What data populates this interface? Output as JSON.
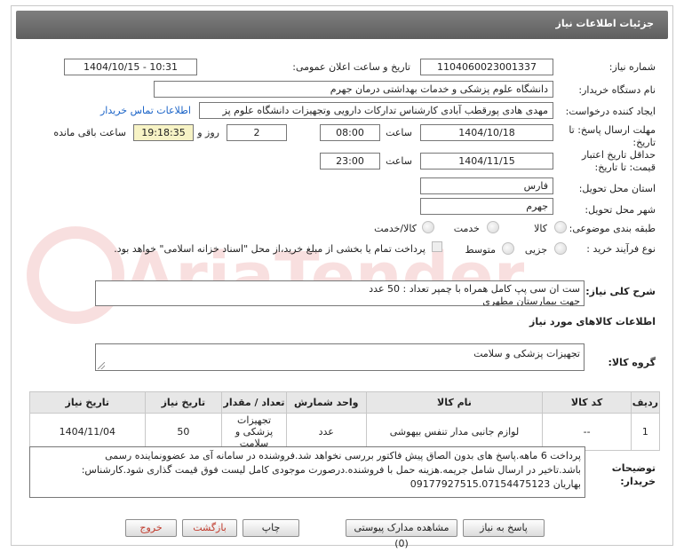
{
  "header": {
    "title": "جزئیات اطلاعات نیاز"
  },
  "watermark": {
    "text": "AriaTender.net"
  },
  "form": {
    "need_number_label": "شماره نیاز:",
    "need_number": "1104060023001337",
    "announce_label": "تاریخ و ساعت اعلان عمومی:",
    "announce_value": "1404/10/15 - 10:31",
    "buyer_org_label": "نام دستگاه خریدار:",
    "buyer_org": "دانشگاه علوم پزشکی و خدمات بهداشتی  درمان جهرم",
    "requester_label": "ایجاد کننده درخواست:",
    "requester": "مهدی هادی پورقطب آبادی کارشناس تدارکات دارویی وتجهیزات دانشگاه علوم پز",
    "contact_link": "اطلاعات تماس خریدار",
    "deadline_label_1": "مهلت ارسال پاسخ: تا",
    "deadline_label_2": "تاریخ:",
    "deadline_date": "1404/10/18",
    "time_label": "ساعت",
    "deadline_time": "08:00",
    "days_value": "2",
    "days_label": "روز و",
    "remaining_time": "19:18:35",
    "remaining_label": "ساعت باقی مانده",
    "validity_label_1": "حداقل تاریخ اعتبار",
    "validity_label_2": "قیمت: تا تاریخ:",
    "validity_date": "1404/11/15",
    "validity_time": "23:00",
    "province_label": "استان محل تحویل:",
    "province": "فارس",
    "city_label": "شهر محل تحویل:",
    "city": "جهرم",
    "category_label": "طبقه بندی موضوعی:",
    "category_options": [
      "کالا",
      "خدمت",
      "کالا/خدمت"
    ],
    "process_label": "نوع فرآیند خرید :",
    "process_options": [
      "جزیی",
      "متوسط"
    ],
    "process_note": "پرداخت تمام یا بخشی از مبلغ خرید،از محل \"اسناد خزانه اسلامی\" خواهد بود."
  },
  "description": {
    "label": "شرح کلی نیاز:",
    "line1": "ست ان سی پپ کامل  همراه با چمپر        تعداد : 50 عدد",
    "line2": "جهت بیمارستان مطهری"
  },
  "goods_info_title": "اطلاعات کالاهای مورد نیاز",
  "goods_group": {
    "label": "گروه کالا:",
    "value": "تجهیزات پزشکی و سلامت"
  },
  "table": {
    "headers": [
      "ردیف",
      "کد کالا",
      "نام کالا",
      "واحد شمارش",
      "تعداد / مقدار",
      "تاریخ نیاز"
    ],
    "rows": [
      [
        "1",
        "--",
        "لوازم جانبی مدار تنفس بیهوشی",
        "عدد",
        "50",
        "1404/11/04"
      ]
    ],
    "row1_unit_detail": "تجهیزات پزشکی و سلامت"
  },
  "buyer_notes": {
    "label_1": "توضیحات",
    "label_2": "خریدار:",
    "line1": "پرداخت 6 ماهه.پاسخ های بدون الصاق پیش فاکتور بررسی نخواهد شد.فروشنده در سامانه آی مد عضوونماینده رسمی",
    "line2": "باشد.تاخیر در ارسال شامل جریمه.هزینه حمل با فروشنده.درصورت موجودی کامل لیست فوق قیمت گذاری شود.کارشناس:",
    "line3": "بهاریان 09177927515.07154475123"
  },
  "buttons": {
    "reply": "پاسخ به نیاز",
    "attachments": "مشاهده مدارک پیوستی (0)",
    "print": "چاپ",
    "back": "بازگشت",
    "exit": "خروج"
  },
  "colors": {
    "header_bg": "#6b6b6b",
    "link": "#1a63c7",
    "remaining_bg": "#f7f3c5",
    "back_text": "#c0392b",
    "exit_text": "#c0392b"
  }
}
